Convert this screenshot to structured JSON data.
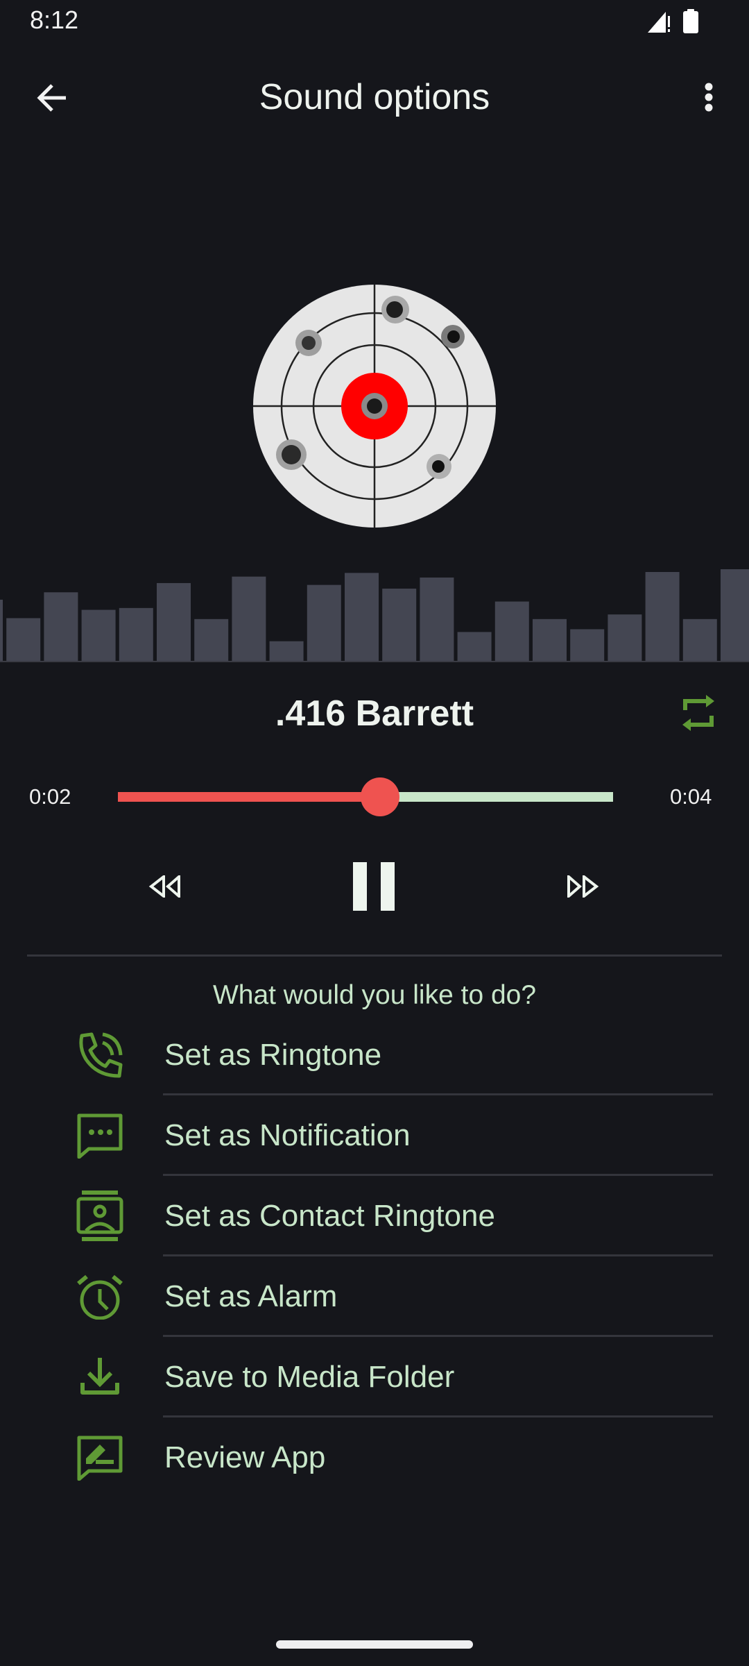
{
  "status_bar": {
    "time": "8:12",
    "signal_icon": "signal-alert-icon",
    "battery_icon": "battery-full-icon"
  },
  "header": {
    "back_icon": "arrow-left-icon",
    "title": "Sound options",
    "menu_icon": "more-vertical-icon"
  },
  "artwork": {
    "description": "Shooting target with bullet holes",
    "icon": "target-icon"
  },
  "waveform": {
    "levels": [
      0.67,
      0.47,
      0.75,
      0.56,
      0.58,
      0.85,
      0.46,
      0.92,
      0.22,
      0.83,
      0.96,
      0.79,
      0.91,
      0.32,
      0.65,
      0.46,
      0.35,
      0.51,
      0.97,
      0.46,
      1.0
    ]
  },
  "player": {
    "track_title": ".416 Barrett",
    "repeat_icon": "repeat-icon",
    "time_current": "0:02",
    "time_total": "0:04",
    "progress": 0.53,
    "rewind_icon": "rewind-icon",
    "pause_icon": "pause-icon",
    "forward_icon": "fast-forward-icon"
  },
  "colors": {
    "background": "#15161b",
    "accent_red": "#ef5350",
    "track_remaining": "#c8e6c9",
    "icon_green": "#5f9a35",
    "label_green": "#c8e6c9",
    "waveform_bar": "#444652"
  },
  "actions": {
    "prompt": "What would you like to do?",
    "items": [
      {
        "label": "Set as Ringtone",
        "icon": "phone-ringing-icon"
      },
      {
        "label": "Set as Notification",
        "icon": "chat-bubble-icon"
      },
      {
        "label": "Set as Contact Ringtone",
        "icon": "contact-card-icon"
      },
      {
        "label": "Set as Alarm",
        "icon": "alarm-clock-icon"
      },
      {
        "label": "Save to Media Folder",
        "icon": "download-icon"
      },
      {
        "label": "Review App",
        "icon": "rate-review-icon"
      }
    ]
  }
}
